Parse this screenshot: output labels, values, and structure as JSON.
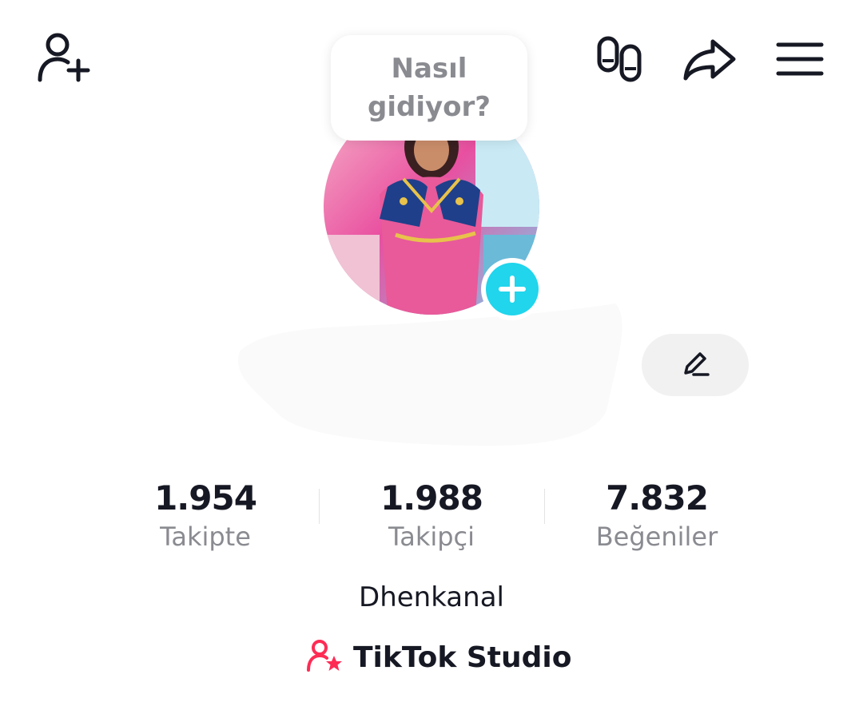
{
  "header": {
    "add_friend_icon": "add-user-icon",
    "footprints_icon": "footprints-icon",
    "share_icon": "share-arrow-icon",
    "menu_icon": "hamburger-menu-icon"
  },
  "bubble": {
    "text": "Nasıl gidiyor?"
  },
  "profile": {
    "add_story_icon": "plus-icon",
    "edit_icon": "pencil-icon"
  },
  "stats": [
    {
      "value": "1.954",
      "label": "Takipte"
    },
    {
      "value": "1.988",
      "label": "Takipçi"
    },
    {
      "value": "7.832",
      "label": "Beğeniler"
    }
  ],
  "bio": "Dhenkanal",
  "studio": {
    "label": "TikTok Studio",
    "icon": "user-star-icon",
    "accent": "#fe2c55"
  },
  "colors": {
    "add_story": "#20d5ec",
    "secondary_text": "#8a8b91",
    "edit_button_bg": "#f1f1f2"
  }
}
